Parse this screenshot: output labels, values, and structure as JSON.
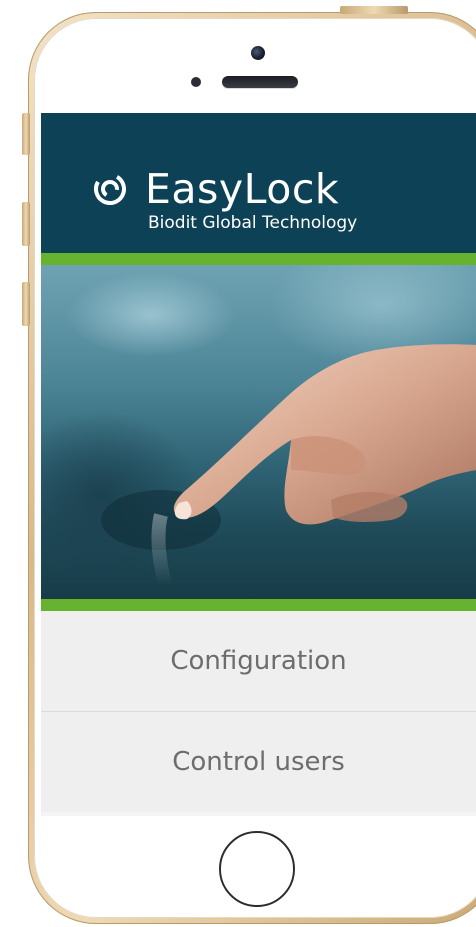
{
  "app": {
    "title": "EasyLock",
    "subtitle": "Biodit Global Technology"
  },
  "menu": {
    "items": [
      {
        "label": "Configuration"
      },
      {
        "label": "Control users"
      }
    ]
  },
  "colors": {
    "header_bg": "#0d4256",
    "accent_green": "#67b22f",
    "menu_bg": "#efefef",
    "menu_text": "#6d6d6d"
  },
  "icons": {
    "logo": "fingerprint-icon"
  }
}
